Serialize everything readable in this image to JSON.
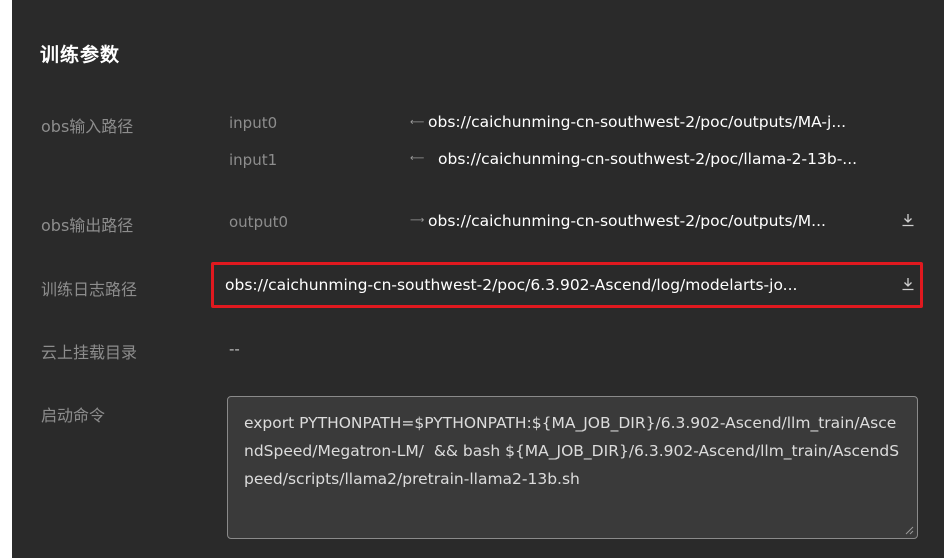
{
  "section": {
    "title": "训练参数"
  },
  "obs_input": {
    "label": "obs输入路径",
    "items": [
      {
        "name": "input0",
        "path": "obs://caichunming-cn-southwest-2/poc/outputs/MA-j..."
      },
      {
        "name": "input1",
        "path": "obs://caichunming-cn-southwest-2/poc/llama-2-13b-..."
      }
    ]
  },
  "obs_output": {
    "label": "obs输出路径",
    "name": "output0",
    "path": "obs://caichunming-cn-southwest-2/poc/outputs/M..."
  },
  "train_log": {
    "label": "训练日志路径",
    "path": "obs://caichunming-cn-southwest-2/poc/6.3.902-Ascend/log/modelarts-jo..."
  },
  "cloud_mount": {
    "label": "云上挂载目录",
    "value": "--"
  },
  "start_command": {
    "label": "启动命令",
    "value": "export PYTHONPATH=$PYTHONPATH:${MA_JOB_DIR}/6.3.902-Ascend/llm_train/AscendSpeed/Megatron-LM/  && bash ${MA_JOB_DIR}/6.3.902-Ascend/llm_train/AscendSpeed/scripts/llama2/pretrain-llama2-13b.sh"
  },
  "icons": {
    "download": "download-icon",
    "input_arrow": "arrow-left-icon",
    "output_arrow": "arrow-right-icon"
  },
  "colors": {
    "background": "#2a2a2a",
    "highlight": "#e0191f",
    "text": "#ffffff",
    "muted": "#8d8d8d"
  }
}
